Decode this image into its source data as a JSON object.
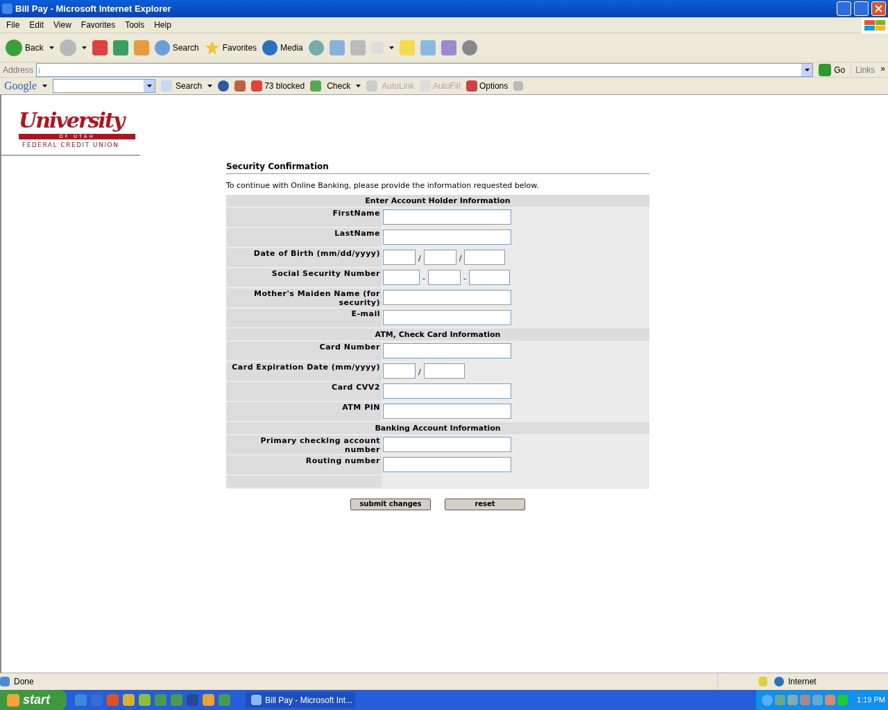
{
  "window": {
    "title": "Bill Pay - Microsoft Internet Explorer"
  },
  "menu": [
    "File",
    "Edit",
    "View",
    "Favorites",
    "Tools",
    "Help"
  ],
  "toolbar": {
    "back": "Back",
    "search": "Search",
    "favorites": "Favorites",
    "media": "Media"
  },
  "address_bar": {
    "label": "Address",
    "value": "¡",
    "go": "Go",
    "links": "Links",
    "more": "»"
  },
  "google_bar": {
    "logo": "Google",
    "search": "Search",
    "blocked": "73 blocked",
    "check": "Check",
    "autolink": "AutoLink",
    "autofill": "AutoFill",
    "options": "Options"
  },
  "page": {
    "logo": {
      "name": "University",
      "sub": "OF UTAH",
      "tagline": "FEDERAL CREDIT UNION"
    },
    "heading": "Security Confirmation",
    "intro": "To continue with Online Banking, please provide the information requested below.",
    "sections": [
      {
        "title": "Enter Account Holder Information",
        "fields": [
          {
            "label": "FirstName",
            "kind": "text"
          },
          {
            "label": "LastName",
            "kind": "text"
          },
          {
            "label": "Date of Birth (mm/dd/yyyy)",
            "kind": "date",
            "separators": [
              "/",
              "/"
            ]
          },
          {
            "label": "Social Security Number",
            "kind": "ssn",
            "separators": [
              "-",
              "-"
            ]
          },
          {
            "label": "Mother's Maiden Name (for security)",
            "kind": "text"
          },
          {
            "label": "E-mail",
            "kind": "text"
          }
        ]
      },
      {
        "title": "ATM, Check Card Information",
        "fields": [
          {
            "label": "Card Number",
            "kind": "text"
          },
          {
            "label": "Card Expiration Date (mm/yyyy)",
            "kind": "expiry",
            "separators": [
              "/"
            ]
          },
          {
            "label": "Card CVV2",
            "kind": "text"
          },
          {
            "label": "ATM PIN",
            "kind": "text"
          }
        ]
      },
      {
        "title": "Banking Account Information",
        "fields": [
          {
            "label": "Primary checking account number",
            "kind": "text"
          },
          {
            "label": "Routing number",
            "kind": "text"
          }
        ]
      }
    ],
    "buttons": [
      "submit changes",
      "reset"
    ]
  },
  "status_bar": {
    "text": "Done",
    "zone": "Internet"
  },
  "taskbar": {
    "start": "start",
    "task": "Bill Pay - Microsoft Int...",
    "clock": "1:19 PM"
  }
}
